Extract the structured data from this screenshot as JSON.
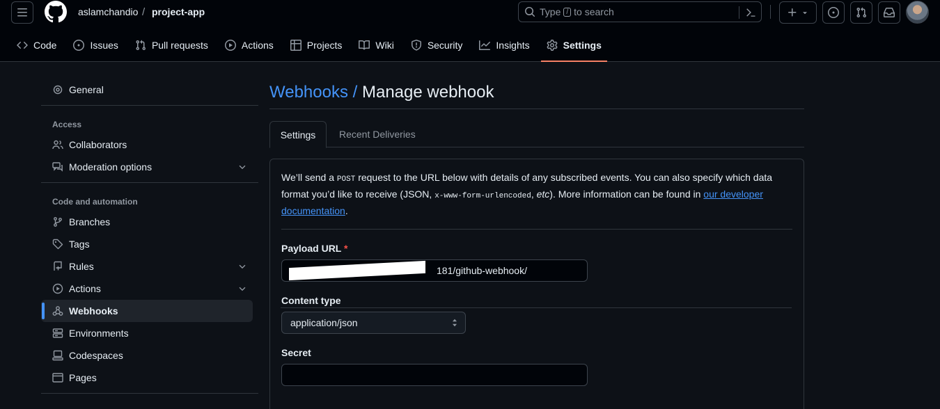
{
  "header": {
    "owner": "aslamchandio",
    "separator": "/",
    "repo": "project-app",
    "search_prefix": "Type",
    "search_key": "/",
    "search_suffix": "to search"
  },
  "nav_tabs": [
    {
      "label": "Code",
      "icon": "code-icon"
    },
    {
      "label": "Issues",
      "icon": "issue-icon"
    },
    {
      "label": "Pull requests",
      "icon": "pull-request-icon"
    },
    {
      "label": "Actions",
      "icon": "play-icon"
    },
    {
      "label": "Projects",
      "icon": "table-icon"
    },
    {
      "label": "Wiki",
      "icon": "book-icon"
    },
    {
      "label": "Security",
      "icon": "shield-icon"
    },
    {
      "label": "Insights",
      "icon": "graph-icon"
    },
    {
      "label": "Settings",
      "icon": "gear-icon",
      "active": true
    }
  ],
  "sidebar": {
    "general": "General",
    "access_heading": "Access",
    "collaborators": "Collaborators",
    "moderation": "Moderation options",
    "code_heading": "Code and automation",
    "branches": "Branches",
    "tags": "Tags",
    "rules": "Rules",
    "actions": "Actions",
    "webhooks": "Webhooks",
    "environments": "Environments",
    "codespaces": "Codespaces",
    "pages": "Pages"
  },
  "page": {
    "breadcrumb_link": "Webhooks",
    "breadcrumb_sep": "/",
    "title": "Manage webhook",
    "tab_settings": "Settings",
    "tab_deliveries": "Recent Deliveries",
    "desc_1": "We’ll send a ",
    "desc_code1": "POST",
    "desc_2": " request to the URL below with details of any subscribed events. You can also specify which data format you’d like to receive (JSON, ",
    "desc_code2": "x-www-form-urlencoded",
    "desc_3": ", ",
    "desc_etc": "etc",
    "desc_4": "). More information can be found in ",
    "desc_link": "our developer documentation",
    "desc_5": ".",
    "payload_label": "Payload URL",
    "required_mark": "*",
    "payload_value": "181/github-webhook/",
    "content_type_label": "Content type",
    "content_type_value": "application/json",
    "secret_label": "Secret",
    "secret_value": ""
  },
  "colors": {
    "accent_blue": "#4493f8",
    "active_underline": "#f78166",
    "required": "#f85149"
  }
}
